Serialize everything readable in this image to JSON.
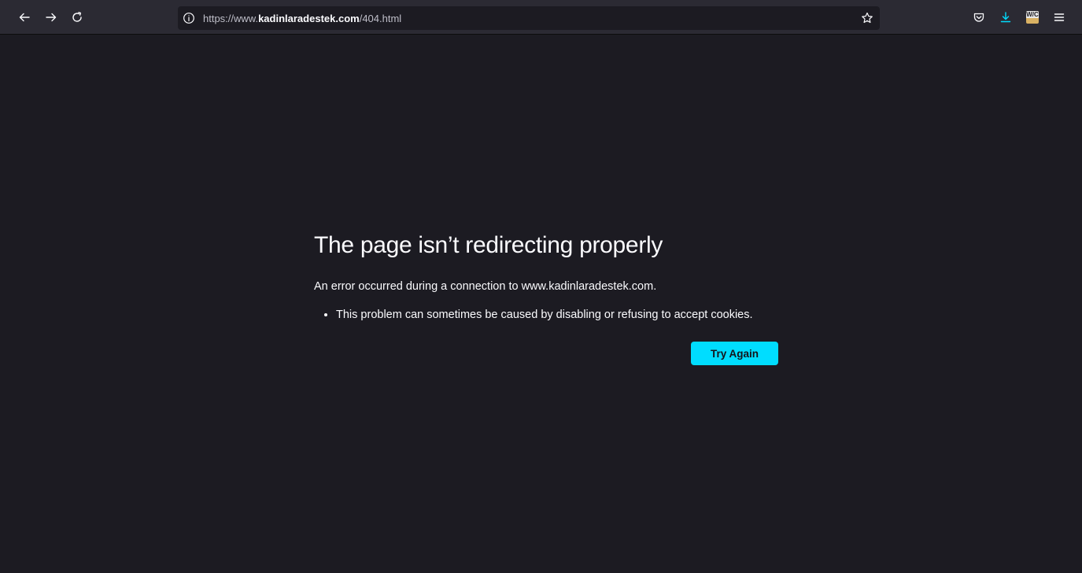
{
  "browser": {
    "url_prefix": "https://www.",
    "url_host": "kadinlaradestek.com",
    "url_path": "/404.html",
    "accent_color": "#00ddff",
    "icons": {
      "back": "back-arrow-icon",
      "forward": "forward-arrow-icon",
      "reload": "reload-icon",
      "site_info": "info-icon",
      "bookmark": "star-icon",
      "pocket": "pocket-icon",
      "downloads": "download-icon",
      "extension": "wc-extension-icon",
      "menu": "hamburger-menu-icon"
    },
    "extension_label": "W/C"
  },
  "error_page": {
    "title": "The page isn’t redirecting properly",
    "description": "An error occurred during a connection to www.kadinlaradestek.com.",
    "bullets": [
      "This problem can sometimes be caused by disabling or refusing to accept cookies."
    ],
    "try_again_label": "Try Again"
  }
}
